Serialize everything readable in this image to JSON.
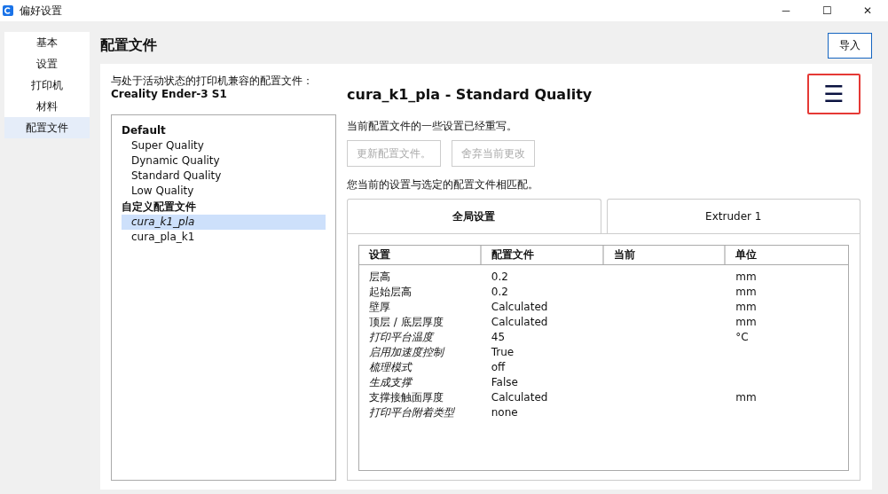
{
  "window": {
    "title": "偏好设置",
    "controls": [
      "─",
      "☐",
      "✕"
    ]
  },
  "sidebar": {
    "items": [
      {
        "label": "基本",
        "selected": false
      },
      {
        "label": "设置",
        "selected": false
      },
      {
        "label": "打印机",
        "selected": false
      },
      {
        "label": "材料",
        "selected": false
      },
      {
        "label": "配置文件",
        "selected": true
      }
    ]
  },
  "page_title": "配置文件",
  "import_button": "导入",
  "compatible_label": "与处于活动状态的打印机兼容的配置文件：",
  "printer_name": "Creality Ender-3 S1",
  "profile_groups": [
    {
      "title": "Default",
      "items": [
        {
          "label": "Super Quality",
          "selected": false,
          "italic": false
        },
        {
          "label": "Dynamic Quality",
          "selected": false,
          "italic": false
        },
        {
          "label": "Standard Quality",
          "selected": false,
          "italic": false
        },
        {
          "label": "Low Quality",
          "selected": false,
          "italic": false
        }
      ]
    },
    {
      "title": "自定义配置文件",
      "items": [
        {
          "label": "cura_k1_pla",
          "selected": true,
          "italic": true
        },
        {
          "label": "cura_pla_k1",
          "selected": false,
          "italic": false
        }
      ]
    }
  ],
  "profile_title": "cura_k1_pla - Standard Quality",
  "menu_button": {
    "icon": "☰",
    "highlighted": true
  },
  "override_note": "当前配置文件的一些设置已经重写。",
  "action_buttons": [
    {
      "label": "更新配置文件。",
      "disabled": true
    },
    {
      "label": "舍弃当前更改",
      "disabled": true
    }
  ],
  "match_note": "您当前的设置与选定的配置文件相匹配。",
  "tabs": [
    {
      "label": "全局设置",
      "selected": true
    },
    {
      "label": "Extruder 1",
      "selected": false
    }
  ],
  "table": {
    "columns": [
      "设置",
      "配置文件",
      "当前",
      "单位"
    ],
    "rows": [
      {
        "setting": "层高",
        "profile": "0.2",
        "current": "",
        "unit": "mm",
        "italic": false
      },
      {
        "setting": "起始层高",
        "profile": "0.2",
        "current": "",
        "unit": "mm",
        "italic": false
      },
      {
        "setting": "壁厚",
        "profile": "Calculated",
        "current": "",
        "unit": "mm",
        "italic": false
      },
      {
        "setting": "顶层 / 底层厚度",
        "profile": "Calculated",
        "current": "",
        "unit": "mm",
        "italic": false
      },
      {
        "setting": "打印平台温度",
        "profile": "45",
        "current": "",
        "unit": "°C",
        "italic": true
      },
      {
        "setting": "启用加速度控制",
        "profile": "True",
        "current": "",
        "unit": "",
        "italic": true
      },
      {
        "setting": "梳理模式",
        "profile": "off",
        "current": "",
        "unit": "",
        "italic": true
      },
      {
        "setting": "生成支撑",
        "profile": "False",
        "current": "",
        "unit": "",
        "italic": true
      },
      {
        "setting": "支撑接触面厚度",
        "profile": "Calculated",
        "current": "",
        "unit": "mm",
        "italic": false
      },
      {
        "setting": "打印平台附着类型",
        "profile": "none",
        "current": "",
        "unit": "",
        "italic": true
      }
    ]
  }
}
